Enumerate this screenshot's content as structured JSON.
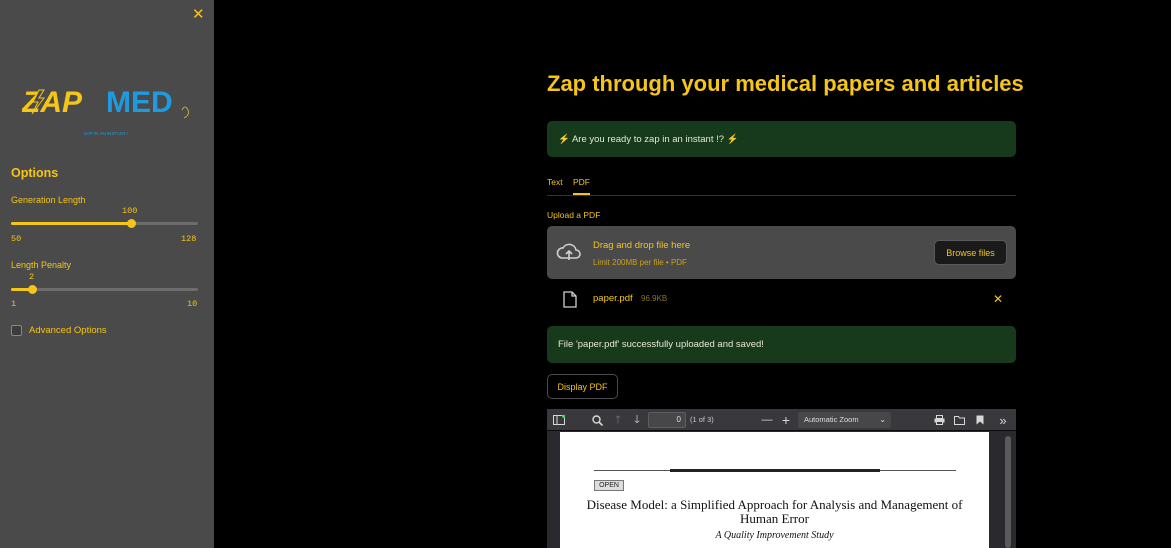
{
  "sidebar": {
    "close_icon": "close-icon",
    "logo": {
      "zap": "ZAP",
      "med": "MED",
      "tagline": "ZAP IN AN INSTANT !"
    },
    "options_title": "Options",
    "generation_length": {
      "label": "Generation Length",
      "value": "100",
      "min": "50",
      "max": "128",
      "fraction": 0.64
    },
    "length_penalty": {
      "label": "Length Penalty",
      "value": "2",
      "min": "1",
      "max": "10",
      "fraction": 0.111
    },
    "advanced_options_label": "Advanced Options"
  },
  "main": {
    "title": "Zap through your medical papers and articles",
    "ready_banner": "⚡ Are you ready to zap in an instant !? ⚡",
    "tabs": [
      {
        "label": "Text"
      },
      {
        "label": "PDF"
      }
    ],
    "active_tab": "PDF",
    "upload_label": "Upload a PDF",
    "dropzone": {
      "main": "Drag and drop file here",
      "sub": "Limit 200MB per file • PDF",
      "browse": "Browse files"
    },
    "file": {
      "name": "paper.pdf",
      "size": "96.9KB"
    },
    "success_banner": "File 'paper.pdf' successfully uploaded and saved!",
    "display_button": "Display PDF",
    "viewer": {
      "page_number": "0",
      "page_of": "(1 of 3)",
      "zoom": "Automatic Zoom",
      "open_tag": "OPEN",
      "doc_title": "Disease Model: a Simplified Approach for Analysis and Management of Human Error",
      "doc_subtitle": "A Quality Improvement Study"
    }
  },
  "colors": {
    "accent": "#f5c518",
    "sidebar_bg": "#4a4a4a",
    "banner_bg": "#163a1b",
    "logo_blue": "#1e9be0"
  }
}
